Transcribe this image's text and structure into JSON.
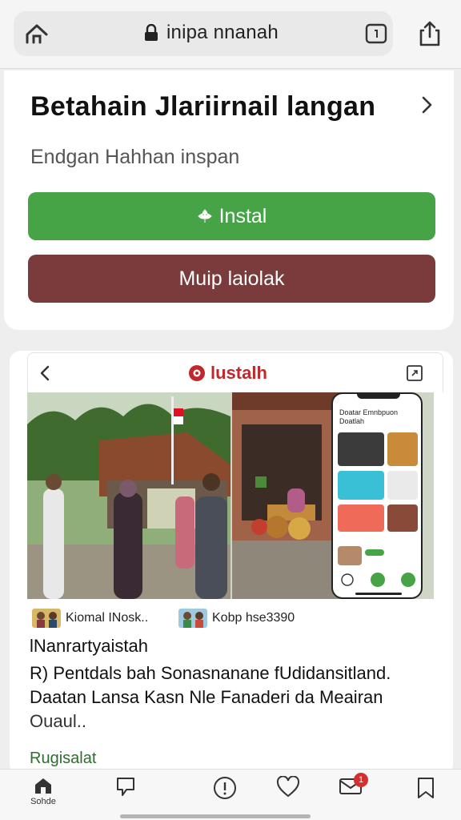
{
  "browser": {
    "url": "inipa nnanah"
  },
  "install_card": {
    "title": "Betahain Jlariirnail langan",
    "subtitle": "Endgan Hahhan inspan",
    "install_label": "Instal",
    "secondary_label": "Muip laiolak"
  },
  "feed": {
    "brand_name": "lustalh",
    "phone_title": "Doatar Emnbpuon Doatlah",
    "tags": [
      {
        "label": "Kiomal INosk.."
      },
      {
        "label": "Kobp hse3390"
      }
    ],
    "author": "lNanrartyaistah",
    "body": "R) Pentdals bah Sonasnanane fUdidansitland. Daatan Lansa Kasn Nle Fanaderi da Meairan",
    "more": "Ouaul..",
    "link": "Rugisalat"
  },
  "bottom_nav": {
    "items": [
      {
        "label": "Sohde",
        "icon": "home-icon"
      },
      {
        "label": "",
        "icon": "comment-icon"
      },
      {
        "label": "",
        "icon": "info-icon"
      },
      {
        "label": "",
        "icon": "heart-icon"
      },
      {
        "label": "",
        "icon": "mail-icon",
        "badge": "1"
      },
      {
        "label": "",
        "icon": "bookmark-icon"
      }
    ]
  },
  "colors": {
    "install_green": "#46a447",
    "secondary_maroon": "#7a3b3d",
    "brand_red": "#c0282d",
    "badge_red": "#d32f2f"
  }
}
